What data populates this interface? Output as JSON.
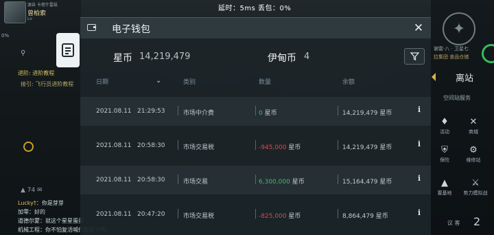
{
  "status_bar": {
    "text": "延时：5ms    丢包：0%"
  },
  "left_hud": {
    "player_sub": "源自   卡塔什雷兹",
    "player_name": "曾柏索",
    "level": "Lv",
    "percent": "0%",
    "quest_line1": "进阶: 进阶教程",
    "quest_line2": "接引: 飞行员进阶教程",
    "chat_icons": "▲ 74     ✉",
    "chat": [
      {
        "name": "Lucky†",
        "text": "：你是芽芽"
      },
      {
        "name": "",
        "text": "加零：好的"
      },
      {
        "name": "",
        "text": "道德尔蒙：就这个星星蛋蛋"
      },
      {
        "name": "",
        "text": "机械工程：你不怕复活喊你脑袋子啊。"
      }
    ]
  },
  "right_hud": {
    "sub1": "谢雷·八 · 卫星七",
    "sub2": "拉集团 食品仓储",
    "leave_station": "离站",
    "station_service": "空间站服务",
    "items": [
      {
        "label": "活动",
        "icon": "♦"
      },
      {
        "label": "商城",
        "icon": "✕"
      },
      {
        "label": "保险",
        "icon": "⛨"
      },
      {
        "label": "维修站",
        "icon": "⚙"
      },
      {
        "label": "置基地",
        "icon": "▲"
      },
      {
        "label": "势力模拟战",
        "icon": "⚔"
      }
    ],
    "bottom_text": "议 客",
    "bottom_num": "2"
  },
  "wallet": {
    "title": "电子钱包",
    "balances": [
      {
        "label": "星币",
        "value": "14,219,479"
      },
      {
        "label": "伊甸币",
        "value": "4"
      }
    ],
    "columns": {
      "date": "日期",
      "category": "类别",
      "amount": "数量",
      "balance": "余额"
    },
    "unit": "星币",
    "rows": [
      {
        "date": "2021.08.11",
        "time": "21:29:53",
        "category": "市场中介费",
        "amount": "0",
        "amount_sign": "zero",
        "balance": "14,219,479"
      },
      {
        "date": "2021.08.11",
        "time": "20:58:30",
        "category": "市场交易税",
        "amount": "-945,000",
        "amount_sign": "neg",
        "balance": "14,219,479"
      },
      {
        "date": "2021.08.11",
        "time": "20:58:30",
        "category": "市场交易",
        "amount": "6,300,000",
        "amount_sign": "pos",
        "balance": "15,164,479"
      },
      {
        "date": "2021.08.11",
        "time": "20:47:20",
        "category": "市场交易税",
        "amount": "-825,000",
        "amount_sign": "neg",
        "balance": "8,864,479"
      }
    ],
    "colors": {
      "negative": "#e34747",
      "positive": "#39c06a"
    }
  }
}
